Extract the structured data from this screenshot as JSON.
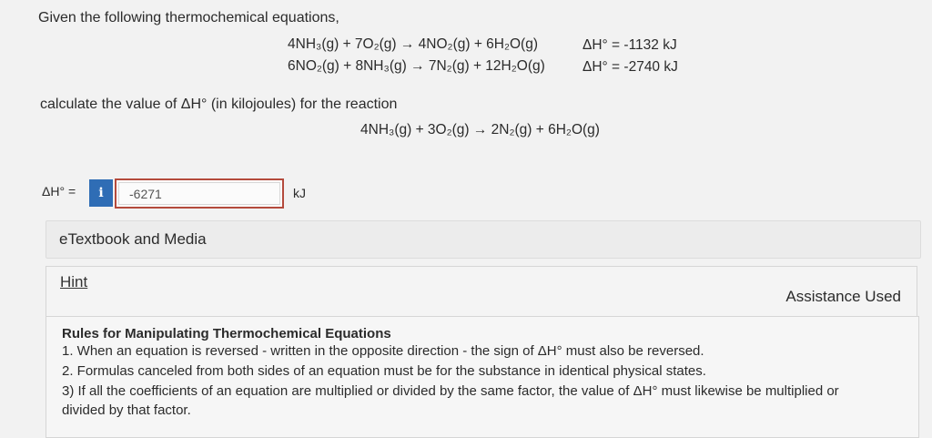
{
  "question": {
    "intro": "Given the following thermochemical equations,",
    "equations": [
      {
        "reaction": "4NH₃(g) + 7O₂(g) → 4NO₂(g) + 6H₂O(g)",
        "delta_h": "ΔH° = -1132 kJ"
      },
      {
        "reaction": "6NO₂(g) + 8NH₃(g) → 7N₂(g) + 12H₂O(g)",
        "delta_h": "ΔH° = -2740 kJ"
      }
    ],
    "calculate": "calculate the value of ΔH° (in kilojoules) for the reaction",
    "target_reaction": "4NH₃(g) + 3O₂(g) → 2N₂(g) + 6H₂O(g)"
  },
  "answer": {
    "label": "ΔH° =",
    "info_icon": "i",
    "value": "-6271",
    "units": "kJ"
  },
  "etextbook": {
    "label": "eTextbook and Media"
  },
  "hint": {
    "label": "Hint",
    "assistance": "Assistance Used",
    "rules_title": "Rules for Manipulating Thermochemical Equations",
    "rule1": "1. When an equation is reversed - written in the opposite direction - the sign of ΔH° must also be reversed.",
    "rule2": "2. Formulas canceled from both sides of an equation must be for the substance in identical physical states.",
    "rule3a": "3) If all the coefficients of an equation are multiplied or divided by the same factor, the value of ΔH° must likewise be multiplied or",
    "rule3b": "divided by that factor."
  }
}
